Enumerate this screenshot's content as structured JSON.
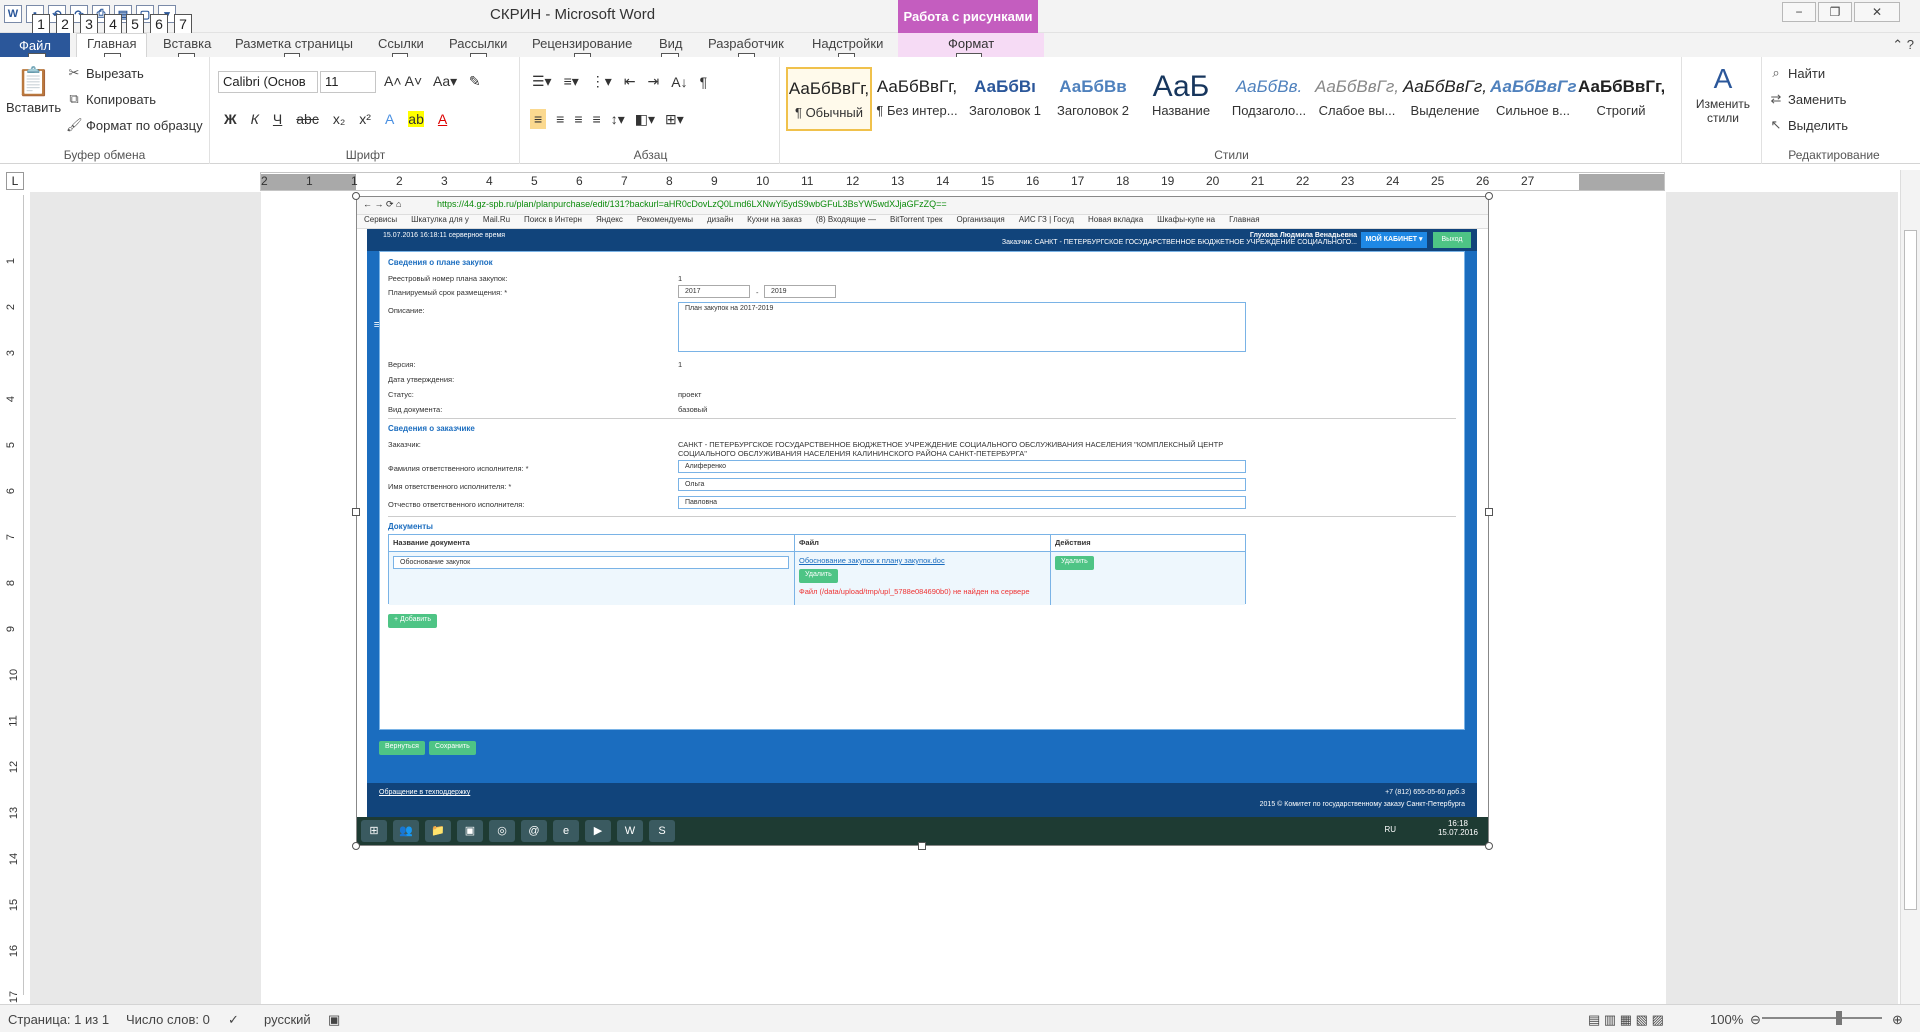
{
  "window": {
    "title": "СКРИН  -  Microsoft Word",
    "context_header": "Работа с рисунками",
    "qat_keytips": [
      "1",
      "2",
      "3",
      "4",
      "5",
      "6",
      "7"
    ],
    "controls": [
      "−",
      "❐",
      "✕"
    ]
  },
  "tabs": [
    {
      "label": "Файл",
      "keytip": "Ф"
    },
    {
      "label": "Главная",
      "keytip": "Я"
    },
    {
      "label": "Вставка",
      "keytip": "С"
    },
    {
      "label": "Разметка страницы",
      "keytip": "З"
    },
    {
      "label": "Ссылки",
      "keytip": "К"
    },
    {
      "label": "Рассылки",
      "keytip": "Л"
    },
    {
      "label": "Рецензирование",
      "keytip": "И"
    },
    {
      "label": "Вид",
      "keytip": "О"
    },
    {
      "label": "Разработчик",
      "keytip": "Ч"
    },
    {
      "label": "Надстройки",
      "keytip": "Н"
    },
    {
      "label": "Формат",
      "keytip": "БЭ"
    }
  ],
  "ribbon": {
    "clipboard": {
      "paste": "Вставить",
      "cut": "Вырезать",
      "copy": "Копировать",
      "format_painter": "Формат по образцу",
      "label": "Буфер обмена"
    },
    "font": {
      "name": "Calibri (Основ",
      "size": "11",
      "label": "Шрифт"
    },
    "paragraph": {
      "label": "Абзац"
    },
    "styles": {
      "label": "Стили",
      "items": [
        {
          "sample": "АаБбВвГг,",
          "name": "¶ Обычный"
        },
        {
          "sample": "АаБбВвГг,",
          "name": "¶ Без интер..."
        },
        {
          "sample": "АаБбВı",
          "name": "Заголовок 1"
        },
        {
          "sample": "АаБбВв",
          "name": "Заголовок 2"
        },
        {
          "sample": "АаБ",
          "name": "Название"
        },
        {
          "sample": "АаБбВв.",
          "name": "Подзаголо..."
        },
        {
          "sample": "АаБбВвГг,",
          "name": "Слабое вы..."
        },
        {
          "sample": "АаБбВвГг,",
          "name": "Выделение"
        },
        {
          "sample": "АаБбВвГг",
          "name": "Сильное в..."
        },
        {
          "sample": "АаБбВвГг,",
          "name": "Строгий"
        }
      ],
      "change": "Изменить стили"
    },
    "editing": {
      "find": "Найти",
      "replace": "Заменить",
      "select": "Выделить",
      "label": "Редактирование"
    }
  },
  "ruler_numbers": [
    "2",
    "1",
    "1",
    "2",
    "3",
    "4",
    "5",
    "6",
    "7",
    "8",
    "9",
    "10",
    "11",
    "12",
    "13",
    "14",
    "15",
    "16",
    "17",
    "18",
    "19",
    "20",
    "21",
    "22",
    "23",
    "24",
    "25",
    "26",
    "27"
  ],
  "vruler_numbers": [
    "1",
    "2",
    "3",
    "4",
    "5",
    "6",
    "7",
    "8",
    "9",
    "10",
    "11",
    "12",
    "13",
    "14",
    "15",
    "16",
    "17"
  ],
  "screenshot": {
    "url": "https://44.gz-spb.ru/plan/planpurchase/edit/131?backurl=aHR0cDovLzQ0Lmd6LXNwYi5ydS9wbGFuL3BsYW5wdXJjaGFzZQ==",
    "bookmarks": [
      "Сервисы",
      "Шкатулка для у",
      "Mail.Ru",
      "Поиск в Интерн",
      "Яндекс",
      "Рекомендуемы",
      "дизайн",
      "Кухни на заказ",
      "(8) Входящие —",
      "BitTorrent трек",
      "Организация",
      "АИС ГЗ | Госуд",
      "Новая вкладка",
      "Шкафы-купе на",
      "Главная"
    ],
    "header_left": "15.07.2016 16:18:11 серверное время",
    "header_user": "Глухова Людмила Венадьевна",
    "header_org": "Заказчик: САНКТ - ПЕТЕРБУРГСКОЕ ГОСУДАРСТВЕННОЕ БЮДЖЕТНОЕ УЧРЕЖДЕНИЕ СОЦИАЛЬНОГО...",
    "my_cabinet": "МОЙ КАБИНЕТ ▾",
    "exit": "Выход",
    "plan_section": "Сведения о плане закупок",
    "reg_label": "Реестровый номер плана закупок:",
    "reg_value": "1",
    "period_label": "Планируемый срок размещения: *",
    "year_from": "2017",
    "year_to": "2019",
    "desc_label": "Описание:",
    "desc_value": "План закупок на 2017-2019",
    "version_label": "Версия:",
    "version_value": "1",
    "approve_label": "Дата утверждения:",
    "status_label": "Статус:",
    "status_value": "проект",
    "doctype_label": "Вид документа:",
    "doctype_value": "базовый",
    "customer_section": "Сведения о заказчике",
    "customer_label": "Заказчик:",
    "customer_value": "САНКТ - ПЕТЕРБУРГСКОЕ ГОСУДАРСТВЕННОЕ БЮДЖЕТНОЕ УЧРЕЖДЕНИЕ СОЦИАЛЬНОГО ОБСЛУЖИВАНИЯ НАСЕЛЕНИЯ \"КОМПЛЕКСНЫЙ ЦЕНТР СОЦИАЛЬНОГО ОБСЛУЖИВАНИЯ НАСЕЛЕНИЯ КАЛИНИНСКОГО РАЙОНА САНКТ-ПЕТЕРБУРГА\"",
    "lastname_label": "Фамилия ответственного исполнителя: *",
    "lastname_value": "Алиференко",
    "firstname_label": "Имя ответственного исполнителя: *",
    "firstname_value": "Ольга",
    "middlename_label": "Отчество ответственного исполнителя:",
    "middlename_value": "Павловна",
    "docs_section": "Документы",
    "col_name": "Название документа",
    "col_file": "Файл",
    "col_actions": "Действия",
    "doc_name_value": "Обоснование закупок",
    "file_link": "Обоснование закупок к плану закупок.doc",
    "delete": "Удалить",
    "file_error": "Файл (/data/upload/tmp/upl_5788e084690b0) не найден на сервере",
    "add": "+ Добавить",
    "back": "Вернуться",
    "save": "Сохранить",
    "support": "Обращение в техподдержку",
    "phone": "+7 (812) 655-05-60 доб.3",
    "copyright": "2015 © Комитет по государственному заказу Санкт-Петербурга",
    "lang": "RU",
    "time": "16:18",
    "date": "15.07.2016"
  },
  "status": {
    "page": "Страница: 1 из 1",
    "words": "Число слов: 0",
    "language": "русский",
    "zoom": "100%"
  },
  "zoom_level": 100
}
